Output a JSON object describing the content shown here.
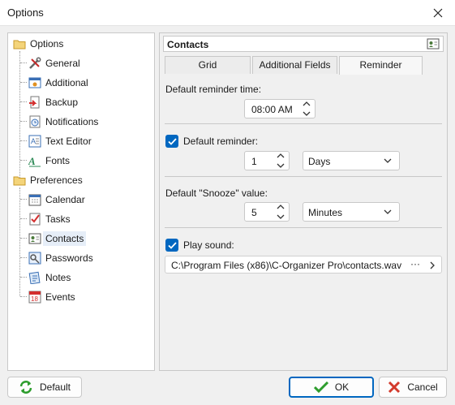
{
  "window": {
    "title": "Options"
  },
  "tree": {
    "groups": [
      {
        "label": "Options",
        "icon": "folder-icon"
      },
      {
        "label": "Preferences",
        "icon": "folder-icon"
      }
    ],
    "items": [
      {
        "label": "General",
        "icon": "tools-icon"
      },
      {
        "label": "Additional",
        "icon": "settings-window-icon"
      },
      {
        "label": "Backup",
        "icon": "backup-icon"
      },
      {
        "label": "Notifications",
        "icon": "notification-icon"
      },
      {
        "label": "Text Editor",
        "icon": "text-editor-icon"
      },
      {
        "label": "Fonts",
        "icon": "fonts-icon"
      },
      {
        "label": "Calendar",
        "icon": "calendar-icon"
      },
      {
        "label": "Tasks",
        "icon": "tasks-icon"
      },
      {
        "label": "Contacts",
        "icon": "contacts-icon"
      },
      {
        "label": "Passwords",
        "icon": "passwords-icon"
      },
      {
        "label": "Notes",
        "icon": "notes-icon"
      },
      {
        "label": "Events",
        "icon": "events-icon"
      }
    ],
    "selected": "Contacts"
  },
  "panel": {
    "title": "Contacts",
    "tabs": [
      {
        "label": "Grid"
      },
      {
        "label": "Additional Fields"
      },
      {
        "label": "Reminder"
      }
    ],
    "active_tab": "Reminder",
    "reminder_time": {
      "label": "Default reminder time:",
      "value": "08:00 AM"
    },
    "default_reminder": {
      "label": "Default reminder:",
      "checked": true,
      "amount": "1",
      "unit": "Days"
    },
    "snooze": {
      "label": "Default \"Snooze\" value:",
      "amount": "5",
      "unit": "Minutes"
    },
    "sound": {
      "label": "Play sound:",
      "checked": true,
      "path": "C:\\Program Files (x86)\\C-Organizer Pro\\contacts.wav",
      "browse": "···"
    }
  },
  "buttons": {
    "default": "Default",
    "ok": "OK",
    "cancel": "Cancel"
  },
  "colors": {
    "accent": "#0067c0",
    "ok_check": "#2e9d2e",
    "cancel_x": "#d33a2c",
    "folder": "#e8c04a"
  }
}
